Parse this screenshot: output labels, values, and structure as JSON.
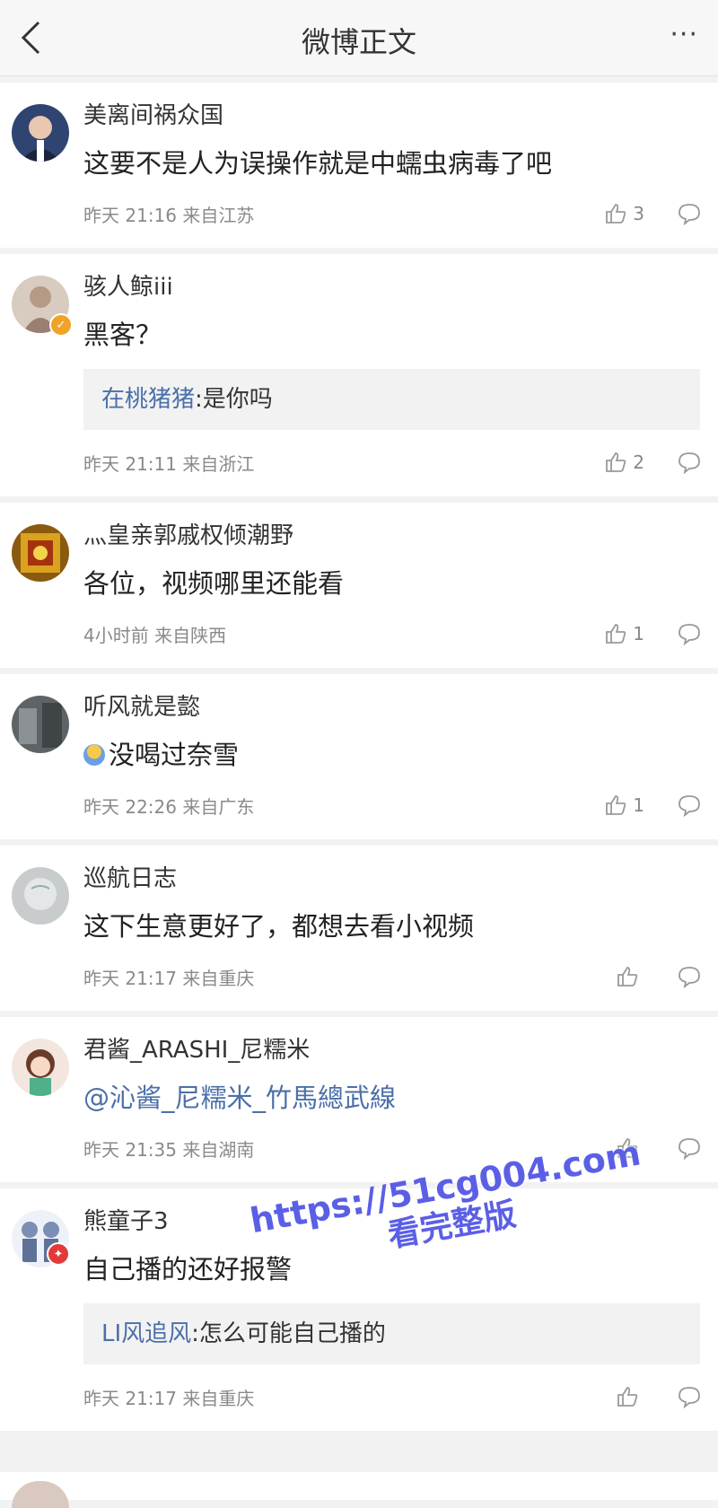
{
  "header": {
    "title": "微博正文",
    "back_icon": "chevron-left-icon",
    "more_label": "···"
  },
  "comments": [
    {
      "username": "美离间祸众国",
      "text": "这要不是人为误操作就是中蠕虫病毒了吧",
      "time": "昨天 21:16 来自江苏",
      "likes": "3",
      "avatar_color": "#3a4f7a"
    },
    {
      "username": "骇人鲸iii",
      "text": "黑客？",
      "reply": {
        "name": "在桃猪猪",
        "text": ":是你吗"
      },
      "time": "昨天 21:11 来自浙江",
      "likes": "2",
      "avatar_color": "#c9b9a8",
      "verified": true
    },
    {
      "username": "灬皇亲郭戚权倾潮野",
      "text": "各位，视频哪里还能看",
      "time": "4小时前 来自陕西",
      "likes": "1",
      "avatar_color": "#b38a1a"
    },
    {
      "username": "听风就是㦤",
      "text": "没喝过奈雪",
      "emoji": "emoji-icon",
      "time": "昨天 22:26 来自广东",
      "likes": "1",
      "avatar_color": "#6b6f72"
    },
    {
      "username": "巡航日志",
      "text": "这下生意更好了，都想去看小视频",
      "time": "昨天 21:17 来自重庆",
      "likes": "",
      "avatar_color": "#cfd3d4"
    },
    {
      "username": "君酱_ARASHI_尼糯米",
      "text": "@沁酱_尼糯米_竹馬總武線",
      "text_is_link": true,
      "time": "昨天 21:35 来自湖南",
      "likes": "",
      "avatar_color": "#f0dfd6"
    },
    {
      "username": "熊童子3",
      "text": "自己播的还好报警",
      "reply": {
        "name": "LI风追风",
        "text": ":怎么可能自己播的"
      },
      "time": "昨天 21:17 来自重庆",
      "likes": "",
      "avatar_color": "#e6ecf5",
      "red_badge": true
    }
  ],
  "watermark": {
    "line1": "https://51cg004.com",
    "line2": "看完整版"
  }
}
